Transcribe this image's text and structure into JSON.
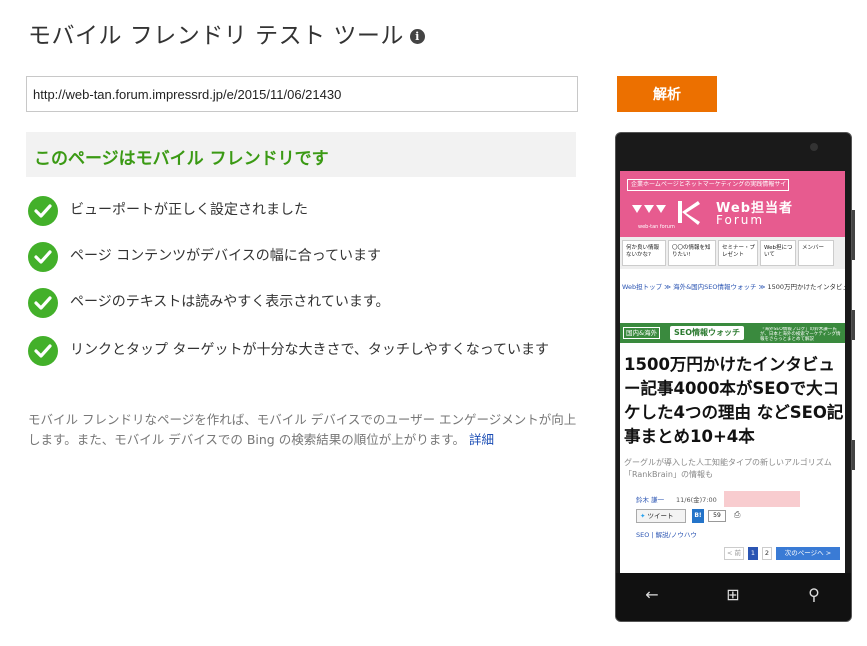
{
  "page": {
    "title": "モバイル フレンドリ テスト ツール",
    "info_glyph": "i"
  },
  "form": {
    "url_value": "http://web-tan.forum.impressrd.jp/e/2015/11/06/21430",
    "analyze_label": "解析"
  },
  "result": {
    "banner": "このページはモバイル フレンドリです",
    "checks": [
      "ビューポートが正しく設定されました",
      "ページ コンテンツがデバイスの幅に合っています",
      "ページのテキストは読みやすく表示されています。",
      "リンクとタップ ターゲットが十分な大きさで、タッチしやすくなっています"
    ],
    "description": "モバイル フレンドリなページを作れば、モバイル デバイスでのユーザー エンゲージメントが向上します。また、モバイル デバイスでの Bing の検索結果の順位が上がります。",
    "details_link": "詳細"
  },
  "preview": {
    "header_tag": "企業ホームページとネットマーケティングの実践情報サイト",
    "site_name": "Web担当者",
    "site_sub": "Forum",
    "logo_caption": "web-tan forum",
    "nav": [
      "何か良い情報ないかな?",
      "〇〇の情報を知りたい!",
      "セミナー・プレゼント",
      "Web担について",
      "メンバー"
    ],
    "breadcrumb_links": "Web担トップ ≫ 海外&国内SEO情報ウォッチ ≫",
    "breadcrumb_current": "1500万円かけたインタビュ...",
    "band_tag": "国内&海外",
    "band_title": "SEO情報ウォッチ",
    "band_note": "「海外SEO情報ブログ」の鈴木謙一氏が、日本と海外の検索マーケティング情報をさらっとまとめて解説",
    "headline": "1500万円かけたインタビュー記事4000本がSEOで大コケした4つの理由 などSEO記事まとめ10+4本",
    "subtitle": "グーグルが導入した人工知能タイプの新しいアルゴリズム「RankBrain」の情報も",
    "author": "鈴木 謙一",
    "date": "11/6(金)7:00",
    "tweet_label": "ツイート",
    "bookmark_label": "B!",
    "bookmark_count": "59",
    "tags": "SEO | 解説/ノウハウ",
    "pager": {
      "prev": "< 前",
      "page1": "1",
      "page2": "2",
      "next": "次のページへ >"
    },
    "phone_buttons": {
      "back": "←",
      "home": "⊞",
      "search": "⚲"
    }
  },
  "colors": {
    "accent_button": "#ec7000",
    "success_green": "#43b02a",
    "banner_text_green": "#3b9a14",
    "site_header_pink": "#e75b8f",
    "link_blue": "#1a4cb4"
  }
}
